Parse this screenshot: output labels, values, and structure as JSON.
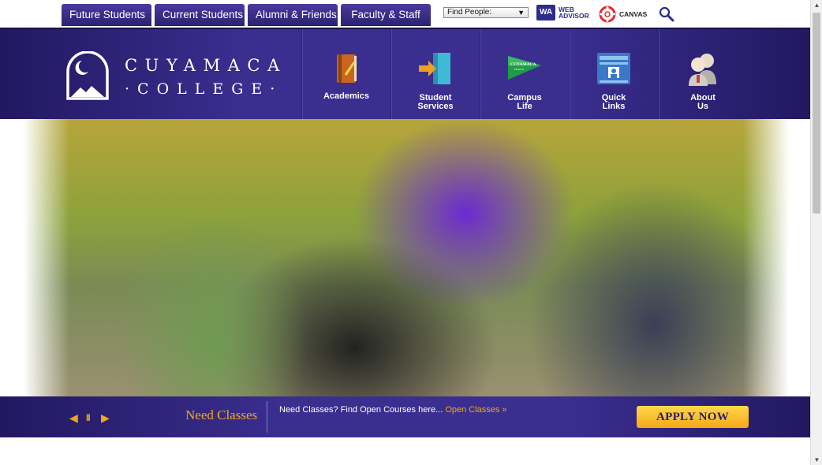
{
  "tabs": [
    {
      "label": "Future Students"
    },
    {
      "label": "Current Students"
    },
    {
      "label": "Alumni & Friends"
    },
    {
      "label": "Faculty & Staff"
    }
  ],
  "find_people": {
    "selected": "Find People:"
  },
  "web_advisor": {
    "badge": "WA",
    "line1": "WEB",
    "line2": "ADVISOR"
  },
  "canvas": {
    "label": "CANVAS"
  },
  "logo": {
    "line1": "CUYAMACA",
    "line2": "·COLLEGE·"
  },
  "nav": [
    {
      "label": "Academics"
    },
    {
      "label1": "Student",
      "label2": "Services"
    },
    {
      "label1": "Campus",
      "label2": "Life",
      "flag_text": "CUYAMACA",
      "flag_sub": "FRONT"
    },
    {
      "label1": "Quick",
      "label2": "Links"
    },
    {
      "label1": "About",
      "label2": "Us"
    }
  ],
  "banner": {
    "title": "Need Classes",
    "text": "Need Classes? Find Open Courses here... ",
    "link": "Open Classes »",
    "apply": "APPLY NOW"
  },
  "colors": {
    "brand_purple": "#3a2e8f",
    "dark_purple": "#221860",
    "gold": "#f0a81c"
  }
}
